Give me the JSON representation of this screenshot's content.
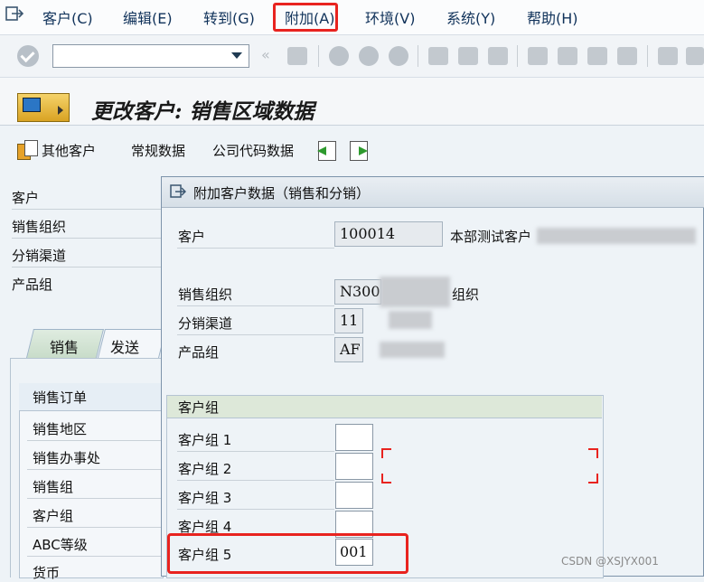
{
  "menu": {
    "items": [
      "客户(C)",
      "编辑(E)",
      "转到(G)",
      "附加(A)",
      "环境(V)",
      "系统(Y)",
      "帮助(H)"
    ],
    "highlighted": "附加(A)"
  },
  "toolbar": {
    "command_field_value": ""
  },
  "title": "更改客户: 销售区域数据",
  "app_toolbar": {
    "other_customer": "其他客户",
    "general_data": "常规数据",
    "company_code_data": "公司代码数据"
  },
  "background_form": {
    "labels": [
      "客户",
      "销售组织",
      "分销渠道",
      "产品组"
    ],
    "tabs": [
      "销售",
      "发送"
    ],
    "group_title": "销售订单",
    "group_items": [
      "销售地区",
      "销售办事处",
      "销售组",
      "客户组",
      "ABC等级",
      "货币"
    ]
  },
  "dialog": {
    "title": "附加客户数据（销售和分销）",
    "customer_label": "客户",
    "customer_value": "100014",
    "customer_name": "本部测试客户",
    "sales_org_label": "销售组织",
    "sales_org_value": "N300",
    "sales_org_suffix": "组织",
    "dist_channel_label": "分销渠道",
    "dist_channel_value": "11",
    "division_label": "产品组",
    "division_value": "AF",
    "group_box_title": "客户组",
    "customer_groups": [
      {
        "label": "客户组 1",
        "value": ""
      },
      {
        "label": "客户组 2",
        "value": ""
      },
      {
        "label": "客户组 3",
        "value": ""
      },
      {
        "label": "客户组 4",
        "value": ""
      },
      {
        "label": "客户组 5",
        "value": "001"
      }
    ]
  },
  "watermark": "CSDN @XSJYX001",
  "colors": {
    "highlight": "#e8231f",
    "menu_text": "#10325a",
    "tab_active": "#c8dcc9"
  }
}
